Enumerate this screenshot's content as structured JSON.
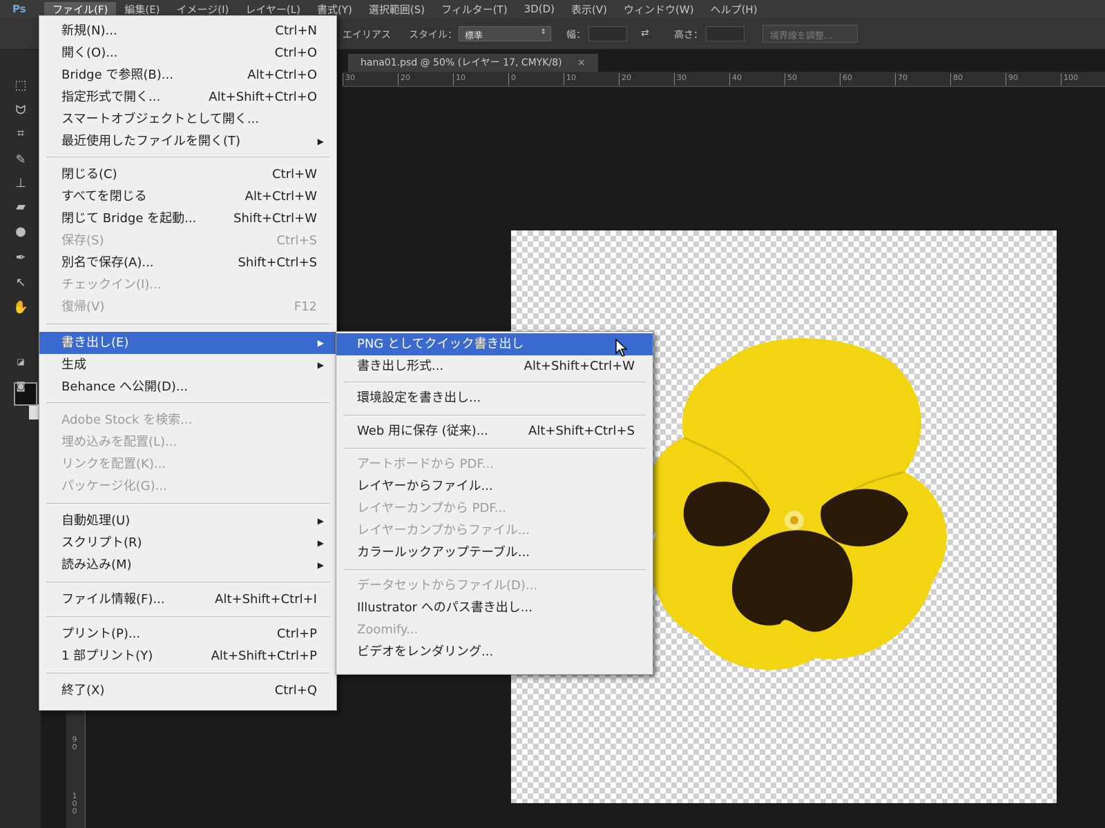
{
  "menubar": {
    "logo": "Ps",
    "items": [
      "ファイル(F)",
      "編集(E)",
      "イメージ(I)",
      "レイヤー(L)",
      "書式(Y)",
      "選択範囲(S)",
      "フィルター(T)",
      "3D(D)",
      "表示(V)",
      "ウィンドウ(W)",
      "ヘルプ(H)"
    ]
  },
  "optionsbar": {
    "antialias": "エイリアス",
    "style_label": "スタイル：",
    "style_value": "標準",
    "width_label": "幅：",
    "height_label": "高さ：",
    "refine_button": "境界線を調整..."
  },
  "document": {
    "tab_title": "hana01.psd @ 50% (レイヤー 17, CMYK/8)",
    "close_glyph": "×",
    "ruler_ticks": [
      "30",
      "20",
      "10",
      "0",
      "10",
      "20",
      "30",
      "40",
      "50",
      "60",
      "70",
      "80",
      "90",
      "100"
    ],
    "vruler_ticks": [
      "9\n0",
      "1\n0\n0"
    ]
  },
  "file_menu": {
    "items": [
      {
        "label": "新規(N)...",
        "shortcut": "Ctrl+N",
        "disabled": false
      },
      {
        "label": "開く(O)...",
        "shortcut": "Ctrl+O",
        "disabled": false
      },
      {
        "label": "Bridge で参照(B)...",
        "shortcut": "Alt+Ctrl+O",
        "disabled": false
      },
      {
        "label": "指定形式で開く...",
        "shortcut": "Alt+Shift+Ctrl+O",
        "disabled": false
      },
      {
        "label": "スマートオブジェクトとして開く...",
        "shortcut": "",
        "disabled": false
      },
      {
        "label": "最近使用したファイルを開く(T)",
        "shortcut": "",
        "submenu": true,
        "disabled": false
      },
      {
        "label": "閉じる(C)",
        "shortcut": "Ctrl+W",
        "disabled": false
      },
      {
        "label": "すべてを閉じる",
        "shortcut": "Alt+Ctrl+W",
        "disabled": false
      },
      {
        "label": "閉じて Bridge を起動...",
        "shortcut": "Shift+Ctrl+W",
        "disabled": false
      },
      {
        "label": "保存(S)",
        "shortcut": "Ctrl+S",
        "disabled": true
      },
      {
        "label": "別名で保存(A)...",
        "shortcut": "Shift+Ctrl+S",
        "disabled": false
      },
      {
        "label": "チェックイン(I)...",
        "shortcut": "",
        "disabled": true
      },
      {
        "label": "復帰(V)",
        "shortcut": "F12",
        "disabled": true
      },
      {
        "label": "書き出し(E)",
        "shortcut": "",
        "submenu": true,
        "highlighted": true,
        "disabled": false
      },
      {
        "label": "生成",
        "shortcut": "",
        "submenu": true,
        "disabled": false
      },
      {
        "label": "Behance へ公開(D)...",
        "shortcut": "",
        "disabled": false
      },
      {
        "label": "Adobe Stock を検索...",
        "shortcut": "",
        "disabled": true
      },
      {
        "label": "埋め込みを配置(L)...",
        "shortcut": "",
        "disabled": true
      },
      {
        "label": "リンクを配置(K)...",
        "shortcut": "",
        "disabled": true
      },
      {
        "label": "パッケージ化(G)...",
        "shortcut": "",
        "disabled": true
      },
      {
        "label": "自動処理(U)",
        "shortcut": "",
        "submenu": true,
        "disabled": false
      },
      {
        "label": "スクリプト(R)",
        "shortcut": "",
        "submenu": true,
        "disabled": false
      },
      {
        "label": "読み込み(M)",
        "shortcut": "",
        "submenu": true,
        "disabled": false
      },
      {
        "label": "ファイル情報(F)...",
        "shortcut": "Alt+Shift+Ctrl+I",
        "disabled": false
      },
      {
        "label": "プリント(P)...",
        "shortcut": "Ctrl+P",
        "disabled": false
      },
      {
        "label": "1 部プリント(Y)",
        "shortcut": "Alt+Shift+Ctrl+P",
        "disabled": false
      },
      {
        "label": "終了(X)",
        "shortcut": "Ctrl+Q",
        "disabled": false
      }
    ]
  },
  "export_submenu": {
    "items": [
      {
        "label": "PNG としてクイック書き出し",
        "shortcut": "",
        "highlighted": true,
        "disabled": false
      },
      {
        "label": "書き出し形式...",
        "shortcut": "Alt+Shift+Ctrl+W",
        "disabled": false
      },
      {
        "label": "環境設定を書き出し...",
        "shortcut": "",
        "disabled": false
      },
      {
        "label": "Web 用に保存 (従来)...",
        "shortcut": "Alt+Shift+Ctrl+S",
        "disabled": false
      },
      {
        "label": "アートボードから PDF...",
        "shortcut": "",
        "disabled": true
      },
      {
        "label": "レイヤーからファイル...",
        "shortcut": "",
        "disabled": false
      },
      {
        "label": "レイヤーカンプから PDF...",
        "shortcut": "",
        "disabled": true
      },
      {
        "label": "レイヤーカンプからファイル...",
        "shortcut": "",
        "disabled": true
      },
      {
        "label": "カラールックアップテーブル...",
        "shortcut": "",
        "disabled": false
      },
      {
        "label": "データセットからファイル(D)...",
        "shortcut": "",
        "disabled": true
      },
      {
        "label": "Illustrator へのパス書き出し...",
        "shortcut": "",
        "disabled": false
      },
      {
        "label": "Zoomify...",
        "shortcut": "",
        "disabled": true
      },
      {
        "label": "ビデオをレンダリング...",
        "shortcut": "",
        "disabled": false
      }
    ]
  },
  "colors": {
    "highlight": "#3a6ad0",
    "flower_yellow": "#f2d411",
    "flower_dark": "#2a1a0a"
  },
  "icons": {
    "tools": [
      "rect-marquee-icon",
      "lasso-icon",
      "crop-icon",
      "brush-icon",
      "stamp-icon",
      "eraser-icon",
      "blur-icon",
      "pen-icon",
      "select-arrow-icon",
      "hand-icon"
    ],
    "cursor": "pointer-cursor-icon"
  }
}
